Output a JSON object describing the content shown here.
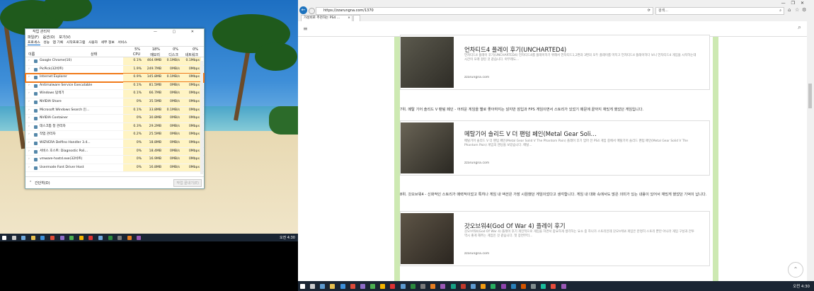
{
  "task_manager": {
    "title": "작업 관리자",
    "menu": [
      "파일(F)",
      "옵션(O)",
      "보기(V)"
    ],
    "tabs": [
      "프로세스",
      "성능",
      "앱 기록",
      "시작프로그램",
      "사용자",
      "세부 정보",
      "서비스"
    ],
    "columns": {
      "name": "이름",
      "status": "상태",
      "cpu_pct": "5%",
      "cpu": "CPU",
      "mem_pct": "18%",
      "mem": "메모리",
      "disk_pct": "0%",
      "disk": "디스크",
      "net_pct": "0%",
      "net": "네트워크"
    },
    "rows": [
      {
        "name": "Google Chrome(10)",
        "cpu": "0.1%",
        "mem": "464.9MB",
        "disk": "0.1MB/s",
        "net": "0.1Mbps"
      },
      {
        "name": "PicPick(32비트)",
        "cpu": "1.9%",
        "mem": "249.7MB",
        "disk": "0MB/s",
        "net": "0Mbps"
      },
      {
        "name": "Internet Explorer",
        "cpu": "0.9%",
        "mem": "145.8MB",
        "disk": "0.1MB/s",
        "net": "0Mbps"
      },
      {
        "name": "Antimalware Service Executable",
        "cpu": "0.1%",
        "mem": "81.5MB",
        "disk": "0MB/s",
        "net": "0Mbps"
      },
      {
        "name": "Windows 탐색기",
        "cpu": "0.1%",
        "mem": "66.7MB",
        "disk": "0MB/s",
        "net": "0Mbps"
      },
      {
        "name": "NVIDIA Share",
        "cpu": "0%",
        "mem": "35.5MB",
        "disk": "0MB/s",
        "net": "0Mbps"
      },
      {
        "name": "Microsoft Windows Search 인...",
        "cpu": "0.1%",
        "mem": "33.8MB",
        "disk": "0.1MB/s",
        "net": "0Mbps"
      },
      {
        "name": "NVIDIA Container",
        "cpu": "0%",
        "mem": "30.8MB",
        "disk": "0MB/s",
        "net": "0Mbps"
      },
      {
        "name": "데스크톱 창 관리자",
        "cpu": "0.3%",
        "mem": "29.2MB",
        "disk": "0MB/s",
        "net": "0Mbps"
      },
      {
        "name": "작업 관리자",
        "cpu": "0.2%",
        "mem": "25.5MB",
        "disk": "0MB/s",
        "net": "0Mbps"
      },
      {
        "name": "WIZVERA Delfino Handler 3.4...",
        "cpu": "0%",
        "mem": "18.8MB",
        "disk": "0MB/s",
        "net": "0Mbps"
      },
      {
        "name": "서비스 호스트: Diagnostic Poli...",
        "cpu": "0%",
        "mem": "18.4MB",
        "disk": "0MB/s",
        "net": "0Mbps"
      },
      {
        "name": "vmware-hostd.exe(32비트)",
        "cpu": "0%",
        "mem": "16.9MB",
        "disk": "0MB/s",
        "net": "0Mbps"
      },
      {
        "name": "Usermode Font Driver Host",
        "cpu": "0%",
        "mem": "16.8MB",
        "disk": "0MB/s",
        "net": "0Mbps"
      }
    ],
    "selected_index": 2,
    "footer_brief": "간단히(D)",
    "footer_end_task": "작업 끝내기(E)"
  },
  "left_taskbar": {
    "clock": "오전 4:30"
  },
  "browser": {
    "url": "https://zzarungna.com/1370",
    "search_placeholder": "검색...",
    "tab_title": "가성비로 추천하는 PS4 ...",
    "window_controls": [
      "—",
      "❐",
      "✕"
    ]
  },
  "article": {
    "cards": [
      {
        "title": "언차티드4 플레이 후기(UNCHARTED4)",
        "desc": "언차티드4 플레이 후기(UNCHARTED4) 언차티드4를 플레이하기 위해서 언차티드1,2편과 3편의 모두 플레이를 마치고 언차티드4 플레이하다 보니 언차티드4 게임을 시작하는데 시간이 오래 걸린 것 같습니다. 아무래도...",
        "site": "zzarungna.com"
      },
      {
        "title": "메탈기어 솔리드 V 더 팬텀 페인(Metal Gear Soli…",
        "desc": "메탈기어 솔리드 V 더 팬텀 페인(Metal Gear Solid V The Phantom Pain) 플레이 후기 엄마 전 PS4 게임 중에서 메탈기어 솔리드 팬텀 페인(Metal Gear Solid V The Phantom Pain) 게임의 엔딩을 보았습니다. 메탈...",
        "site": "zzarungna.com"
      },
      {
        "title": "갓오브워4(God Of War 4) 플레이 후기",
        "desc": "갓오브워4(God Of War 4) 플레이 후기 개인적으로 게임을 하면서 중요하게 생각하는 요소 중 하나가 스토리인데 갓오브워4 게임은 분명히 스토리 뿐만 아니라 게임 구성과 전투 역시 좋게 해주는 게임인 것 같습니다. 첫 장면부터...",
        "site": "zzarungna.com"
      }
    ],
    "para1": "7위. 메탈 기어 솔리드 V 팬텀 페인 - 어려운 게임을 별로 좋아하지는 않지만 잠입과 FPS 게임이면서 스토리가 있었기 때문에 끝까지 재밌게 했었던 게임입니다.",
    "para2": "8위. 갓오브워4 - 신화적인 스토리가 매력적이었고 특히나 게임 내 액션은 가장 시원했던 게임이었다고 생각합니다. 게임 내 대화 속에서도 많은 의미가 있는 내용이 있어서 재밌게 했었던 기억이 납니다."
  },
  "right_taskbar": {
    "clock": "오전 4:30"
  }
}
